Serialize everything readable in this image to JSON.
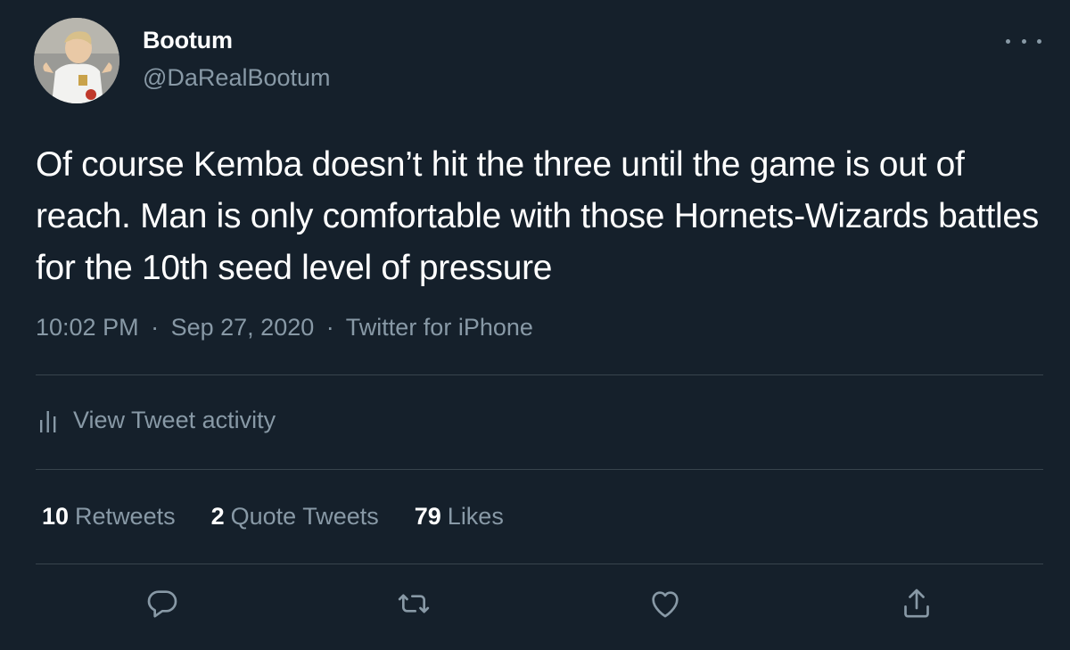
{
  "author": {
    "display_name": "Bootum",
    "handle": "@DaRealBootum"
  },
  "tweet": {
    "text": "Of course Kemba doesn’t hit the three until the game is out of reach. Man is only comfortable with those Hornets-Wizards battles for the 10th seed level of pressure",
    "time": "10:02 PM",
    "date": "Sep 27, 2020",
    "source": "Twitter for iPhone",
    "separator": "·"
  },
  "activity": {
    "label": "View Tweet activity",
    "icon": "analytics-icon"
  },
  "stats": {
    "retweets_count": "10",
    "retweets_label": "Retweets",
    "quotes_count": "2",
    "quotes_label": "Quote Tweets",
    "likes_count": "79",
    "likes_label": "Likes"
  },
  "actions": {
    "reply_icon": "reply-icon",
    "retweet_icon": "retweet-icon",
    "like_icon": "heart-icon",
    "share_icon": "share-icon"
  },
  "colors": {
    "background": "#15202b",
    "text": "#ffffff",
    "secondary": "#8899a6",
    "divider": "#38444d"
  }
}
